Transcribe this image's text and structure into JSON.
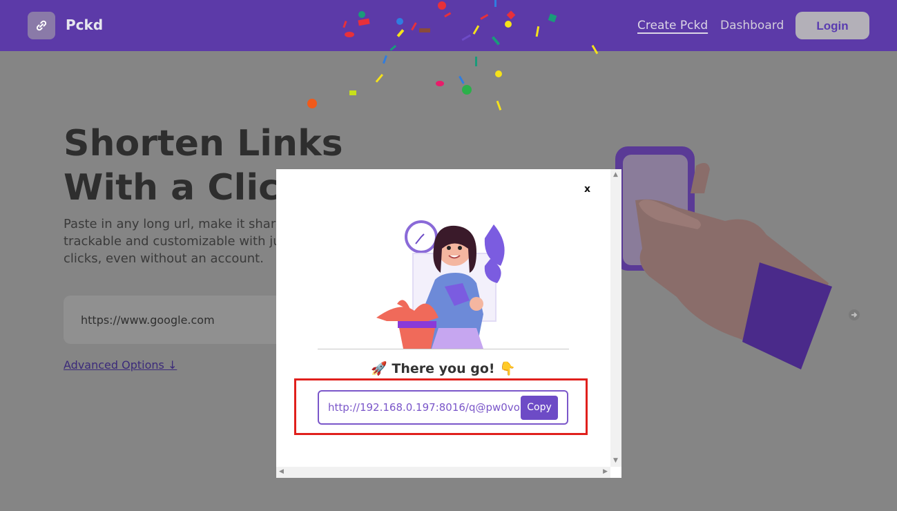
{
  "navbar": {
    "brand": "Pckd",
    "links": [
      "Create Pckd",
      "Dashboard"
    ],
    "login_label": "Login"
  },
  "hero": {
    "title_line1": "Shorten Links",
    "title_line2": "With a Click",
    "subtitle": "Paste in any long url, make it shareable, trackable and customizable with just a few clicks, even without an account.",
    "url_input_value": "https://www.google.com",
    "advanced_options": "Advanced Options ↓"
  },
  "modal": {
    "close_label": "x",
    "success_message": "🚀 There you go! 👇",
    "short_url": "http://192.168.0.197:8016/q@pw0vo",
    "copy_label": "Copy"
  },
  "colors": {
    "brand": "#5c3aa8",
    "accent": "#6d4bc6",
    "highlight": "#e0201c"
  }
}
